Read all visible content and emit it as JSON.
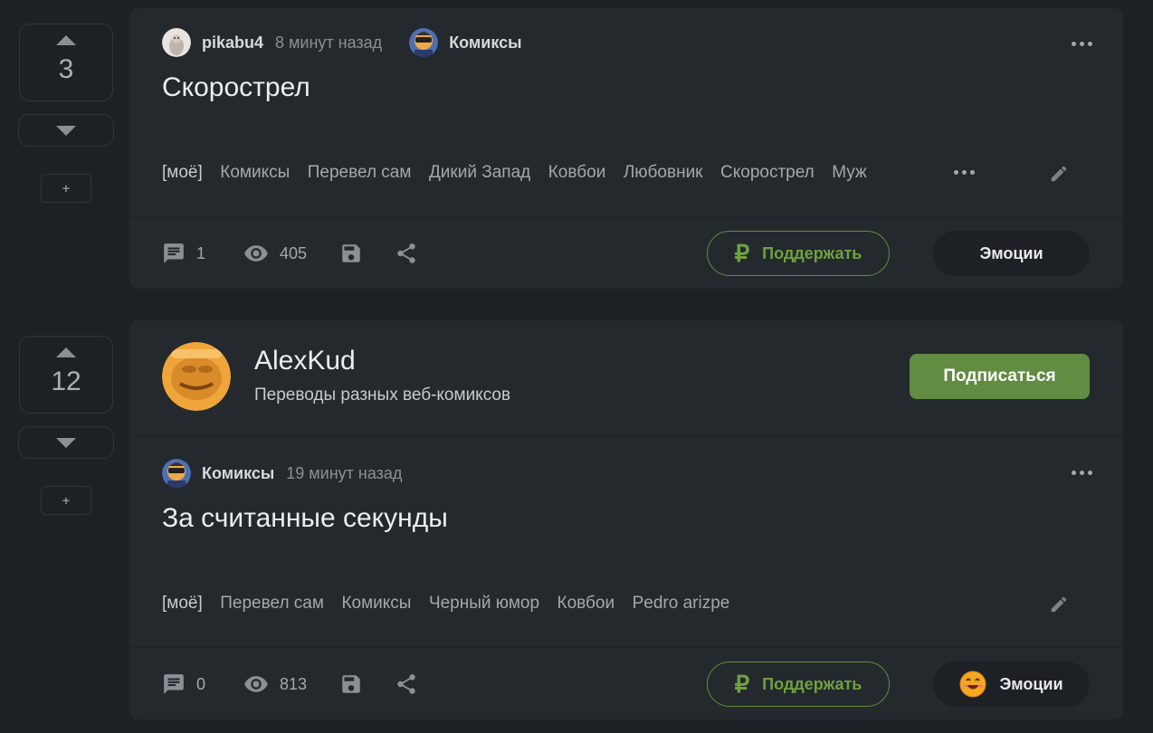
{
  "posts": [
    {
      "rating": "3",
      "author": "pikabu4",
      "time": "8 минут назад",
      "community": "Комиксы",
      "title": "Скорострел",
      "tags": [
        "[моё]",
        "Комиксы",
        "Перевел сам",
        "Дикий Запад",
        "Ковбои",
        "Любовник",
        "Скорострел",
        "Муж"
      ],
      "comments": "1",
      "views": "405",
      "support_label": "Поддержать",
      "emotions_label": "Эмоции"
    },
    {
      "rating": "12",
      "blog": {
        "name": "AlexKud",
        "description": "Переводы разных веб-комиксов",
        "subscribe_label": "Подписаться"
      },
      "community": "Комиксы",
      "time": "19 минут назад",
      "title": "За считанные секунды",
      "tags": [
        "[моё]",
        "Перевел сам",
        "Комиксы",
        "Черный юмор",
        "Ковбои",
        "Pedro arizpe"
      ],
      "comments": "0",
      "views": "813",
      "support_label": "Поддержать",
      "emotions_label": "Эмоции"
    }
  ],
  "vote_plus": "+",
  "support_symbol": "₽",
  "colors": {
    "background": "#1d2125",
    "card": "#24292e",
    "accent_green": "#6fa13e",
    "subscribe_bg": "#618c41"
  },
  "icons": [
    "arrow-up-icon",
    "arrow-down-icon",
    "comment-icon",
    "eye-icon",
    "save-icon",
    "share-icon",
    "pencil-icon",
    "more-dots-icon",
    "ruble-icon",
    "emoji-icon"
  ]
}
